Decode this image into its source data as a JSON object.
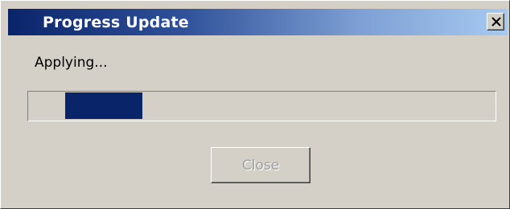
{
  "window": {
    "title": "Progress Update",
    "close_glyph": "close-icon"
  },
  "status": {
    "label": "Applying..."
  },
  "progress": {
    "fraction": 0.16
  },
  "actions": {
    "close_label": "Close",
    "close_enabled": false
  },
  "colors": {
    "title_gradient_start": "#0a246a",
    "title_gradient_end": "#a6caf0",
    "progress_fill": "#0a246a",
    "window_background": "#d4d0c8",
    "disabled_text": "#a0a0a0"
  }
}
